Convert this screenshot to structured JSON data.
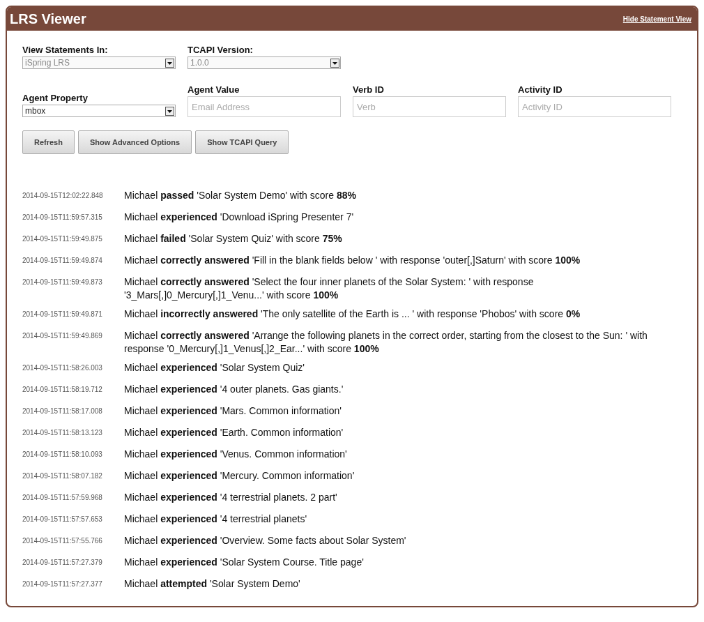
{
  "window": {
    "title": "LRS Viewer",
    "header_link": "Hide Statement View"
  },
  "filters_row_1": [
    {
      "label": "View Statements In:",
      "value": "iSpring LRS",
      "disabled": true
    },
    {
      "label": "TCAPI Version:",
      "value": "1.0.0",
      "disabled": true
    }
  ],
  "agent_property": {
    "label": "Agent Property",
    "value": "mbox",
    "disabled": false
  },
  "text_fields": [
    {
      "label": "Agent Value",
      "placeholder": "Email Address"
    },
    {
      "label": "Verb ID",
      "placeholder": "Verb"
    },
    {
      "label": "Activity ID",
      "placeholder": "Activity ID"
    }
  ],
  "buttons": [
    "Refresh",
    "Show Advanced Options",
    "Show TCAPI Query"
  ],
  "statements": [
    {
      "timestamp": "2014-09-15T12:02:22.848",
      "text": "Michael **passed** 'Solar System Demo' with score **88%**"
    },
    {
      "timestamp": "2014-09-15T11:59:57.315",
      "text": "Michael **experienced** 'Download iSpring Presenter 7'"
    },
    {
      "timestamp": "2014-09-15T11:59:49.875",
      "text": "Michael **failed** 'Solar System Quiz' with score **75%**"
    },
    {
      "timestamp": "2014-09-15T11:59:49.874",
      "text": "Michael **correctly answered** 'Fill in the blank fields below ' with response 'outer[,]Saturn' with score **100%**"
    },
    {
      "timestamp": "2014-09-15T11:59:49.873",
      "text": "Michael **correctly answered** 'Select the four inner planets of the Solar System: ' with response '3_Mars[,]0_Mercury[,]1_Venu...' with score **100%**"
    },
    {
      "timestamp": "2014-09-15T11:59:49.871",
      "text": "Michael **incorrectly answered** 'The only satellite of the Earth is ... ' with response 'Phobos' with score **0%**"
    },
    {
      "timestamp": "2014-09-15T11:59:49.869",
      "text": "Michael **correctly answered** 'Arrange the following planets in the correct order, starting from the closest to the Sun: ' with response '0_Mercury[,]1_Venus[,]2_Ear...' with score **100%**"
    },
    {
      "timestamp": "2014-09-15T11:58:26.003",
      "text": "Michael **experienced** 'Solar System Quiz'"
    },
    {
      "timestamp": "2014-09-15T11:58:19.712",
      "text": "Michael **experienced** '4 outer planets. Gas giants.'"
    },
    {
      "timestamp": "2014-09-15T11:58:17.008",
      "text": "Michael **experienced** 'Mars. Common information'"
    },
    {
      "timestamp": "2014-09-15T11:58:13.123",
      "text": "Michael **experienced** 'Earth. Common information'"
    },
    {
      "timestamp": "2014-09-15T11:58:10.093",
      "text": "Michael **experienced** 'Venus. Common information'"
    },
    {
      "timestamp": "2014-09-15T11:58:07.182",
      "text": "Michael **experienced** 'Mercury. Common information'"
    },
    {
      "timestamp": "2014-09-15T11:57:59.968",
      "text": "Michael **experienced** '4 terrestrial planets. 2 part'"
    },
    {
      "timestamp": "2014-09-15T11:57:57.653",
      "text": "Michael **experienced** '4 terrestrial planets'"
    },
    {
      "timestamp": "2014-09-15T11:57:55.766",
      "text": "Michael **experienced** 'Overview. Some facts about Solar System'"
    },
    {
      "timestamp": "2014-09-15T11:57:27.379",
      "text": "Michael **experienced** 'Solar System Course. Title page'"
    },
    {
      "timestamp": "2014-09-15T11:57:27.377",
      "text": "Michael **attempted** 'Solar System Demo'"
    }
  ]
}
